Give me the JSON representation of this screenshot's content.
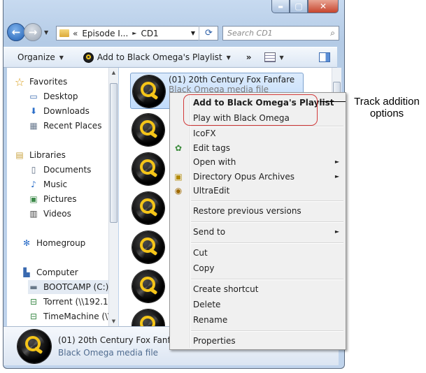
{
  "window": {
    "controls": {
      "minimize": "▬",
      "maximize": "▢",
      "close": "✕"
    }
  },
  "navigation": {
    "back_icon": "←",
    "forward_icon": "→",
    "address_path": [
      "Episode I...",
      "CD1"
    ],
    "path_separator": "«",
    "path_arrow": "►",
    "refresh_icon": "⟳",
    "search_placeholder": "Search CD1"
  },
  "toolbar": {
    "organize_label": "Organize",
    "add_playlist_label": "Add to Black Omega's Playlist",
    "more_label": "»"
  },
  "sidebar": {
    "items": [
      {
        "label": "Favorites",
        "icon": "star-icon",
        "glyph": "☆"
      },
      {
        "label": "Desktop",
        "icon": "desktop-icon",
        "glyph": "▭"
      },
      {
        "label": "Downloads",
        "icon": "downloads-icon",
        "glyph": "⬇"
      },
      {
        "label": "Recent Places",
        "icon": "recent-places-icon",
        "glyph": "▦"
      },
      {
        "label": "Libraries",
        "icon": "libraries-icon",
        "glyph": "▤"
      },
      {
        "label": "Documents",
        "icon": "documents-icon",
        "glyph": "▯"
      },
      {
        "label": "Music",
        "icon": "music-icon",
        "glyph": "♪"
      },
      {
        "label": "Pictures",
        "icon": "pictures-icon",
        "glyph": "▣"
      },
      {
        "label": "Videos",
        "icon": "videos-icon",
        "glyph": "▥"
      },
      {
        "label": "Homegroup",
        "icon": "homegroup-icon",
        "glyph": "✻"
      },
      {
        "label": "Computer",
        "icon": "computer-icon",
        "glyph": "▙"
      },
      {
        "label": "BOOTCAMP (C:)",
        "icon": "drive-icon",
        "glyph": "▬"
      },
      {
        "label": "Torrent (\\\\192.16",
        "icon": "network-drive-icon",
        "glyph": "⊟"
      },
      {
        "label": "TimeMachine (\\\\",
        "icon": "network-drive-icon",
        "glyph": "⊟"
      }
    ]
  },
  "files": {
    "selected_name": "(01) 20th Century Fox Fanfare",
    "selected_type": "Black Omega media file"
  },
  "details_pane": {
    "name": "(01) 20th Century Fox Fanfare",
    "type": "Black Omega media file"
  },
  "context_menu": {
    "items": [
      {
        "label": "Add to Black Omega's Playlist",
        "bold": true
      },
      {
        "label": "Play with Black Omega"
      },
      {
        "label": "IcoFX"
      },
      {
        "label": "Edit tags",
        "icon": "edit-tags-icon"
      },
      {
        "label": "Open with",
        "submenu": true
      },
      {
        "label": "Directory Opus Archives",
        "icon": "archive-icon",
        "submenu": true
      },
      {
        "label": "UltraEdit",
        "icon": "ultraedit-icon"
      },
      {
        "label": "Restore previous versions"
      },
      {
        "label": "Send to",
        "submenu": true
      },
      {
        "label": "Cut"
      },
      {
        "label": "Copy"
      },
      {
        "label": "Create shortcut"
      },
      {
        "label": "Delete"
      },
      {
        "label": "Rename"
      },
      {
        "label": "Properties"
      }
    ],
    "submenu_arrow": "►"
  },
  "annotation": {
    "text_line1": "Track addition",
    "text_line2": "options"
  }
}
